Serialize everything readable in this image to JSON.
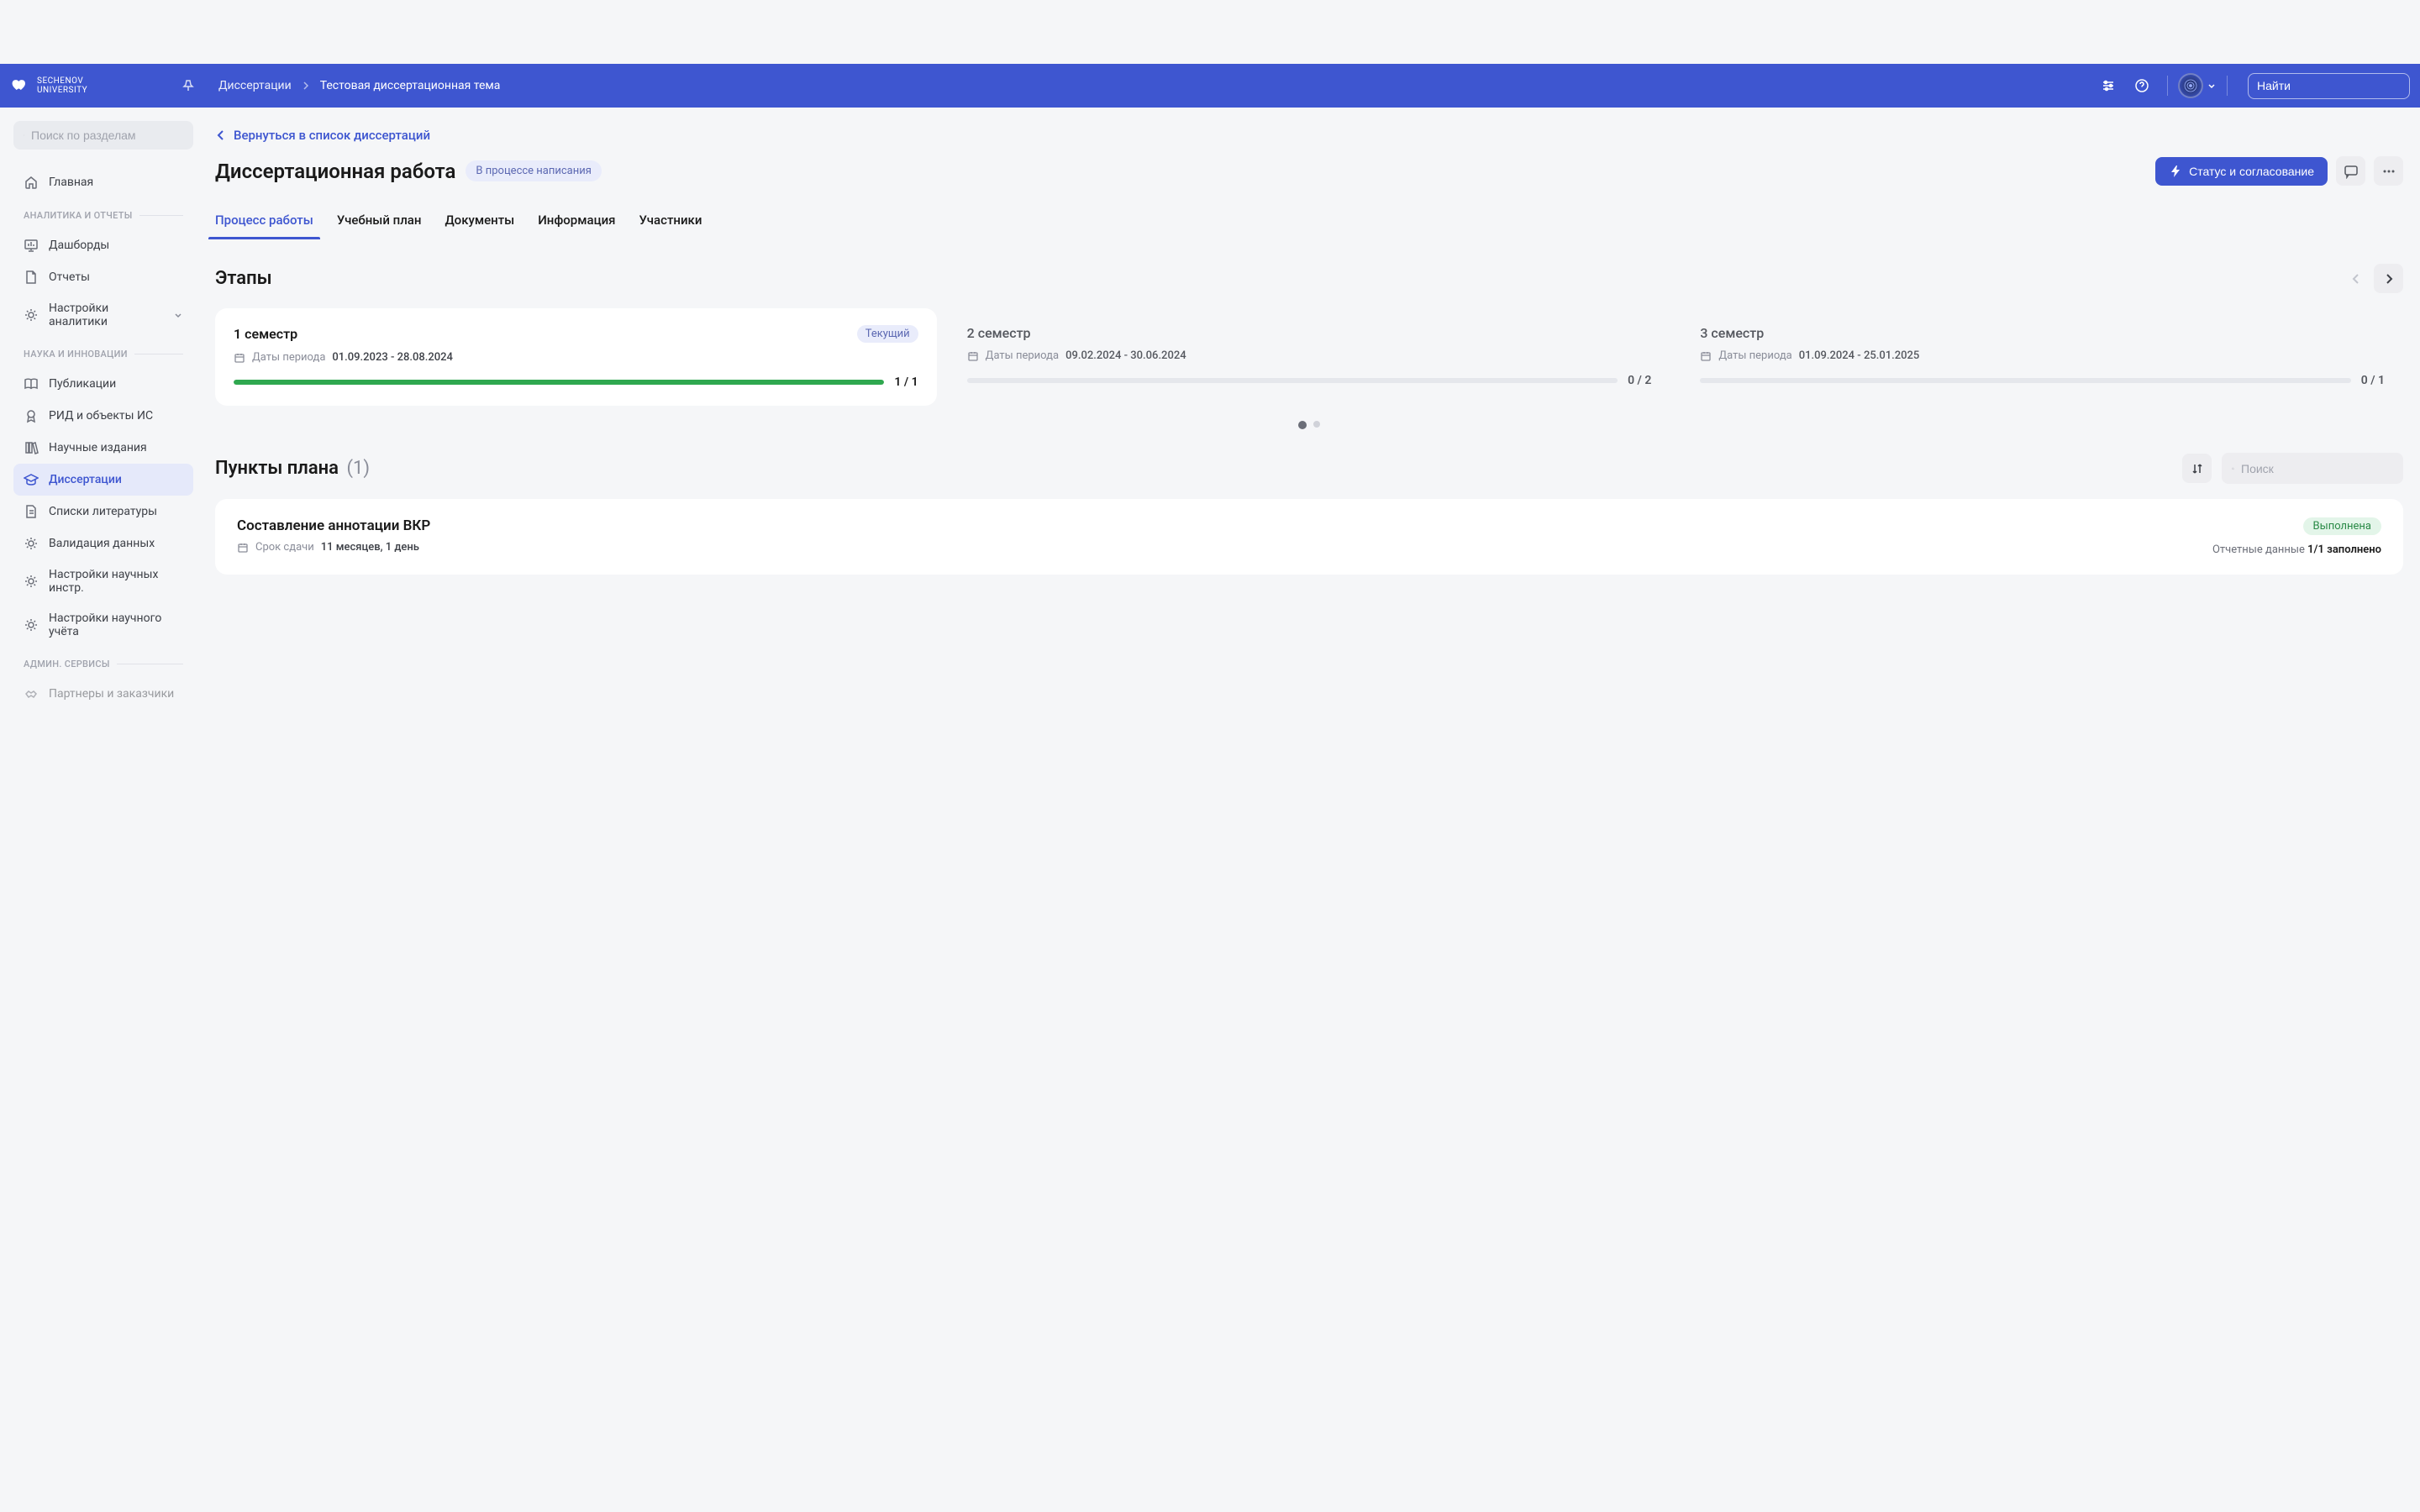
{
  "header": {
    "logo_text": "SECHENOV\nUNIVERSITY",
    "breadcrumb_root": "Диссертации",
    "breadcrumb_current": "Тестовая диссертационная тема",
    "search_placeholder": "Найти"
  },
  "sidebar": {
    "search_placeholder": "Поиск по разделам",
    "home": "Главная",
    "group_analytics": "АНАЛИТИКА И ОТЧЕТЫ",
    "dashboards": "Дашборды",
    "reports": "Отчеты",
    "analytics_settings": "Настройки аналитики",
    "group_science": "НАУКА И ИННОВАЦИИ",
    "publications": "Публикации",
    "rid": "РИД и объекты ИС",
    "science_editions": "Научные издания",
    "dissertations": "Диссертации",
    "lit_lists": "Списки литературы",
    "data_validation": "Валидация данных",
    "sci_instr_settings": "Настройки научных инстр.",
    "sci_account_settings": "Настройки научного учёта",
    "group_admin": "АДМИН. СЕРВИСЫ",
    "partners": "Партнеры и заказчики"
  },
  "main": {
    "back_text": "Вернуться в список диссертаций",
    "page_title": "Диссертационная работа",
    "status_label": "В процессе написания",
    "status_button": "Статус и согласование",
    "tabs": {
      "process": "Процесс работы",
      "study_plan": "Учебный план",
      "documents": "Документы",
      "information": "Информация",
      "participants": "Участники"
    },
    "stages_title": "Этапы",
    "stages": [
      {
        "title": "1 семестр",
        "badge": "Текущий",
        "dates_label": "Даты периода",
        "dates": "01.09.2023 - 28.08.2024",
        "progress_pct": 100,
        "progress_text": "1 / 1"
      },
      {
        "title": "2 семестр",
        "dates_label": "Даты периода",
        "dates": "09.02.2024 - 30.06.2024",
        "progress_pct": 0,
        "progress_text": "0 / 2"
      },
      {
        "title": "3 семестр",
        "dates_label": "Даты периода",
        "dates": "01.09.2024 - 25.01.2025",
        "progress_pct": 0,
        "progress_text": "0 / 1"
      }
    ],
    "plan": {
      "title": "Пункты плана",
      "count": "(1)",
      "search_placeholder": "Поиск",
      "items": [
        {
          "title": "Составление аннотации ВКР",
          "deadline_label": "Срок сдачи",
          "deadline_value": "11 месяцев, 1 день",
          "status": "Выполнена",
          "report_label": "Отчетные данные",
          "report_value": "1/1 заполнено"
        }
      ]
    }
  }
}
